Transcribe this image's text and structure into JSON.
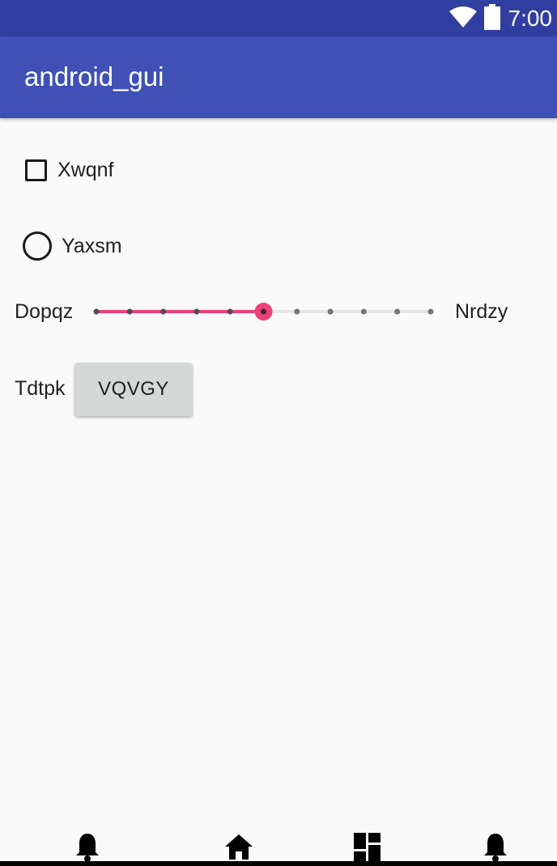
{
  "status_bar": {
    "time": "7:00",
    "icons": [
      "wifi-icon",
      "battery-icon"
    ],
    "color": "#303f9f"
  },
  "app_bar": {
    "title": "android_gui",
    "color": "#3f51b5"
  },
  "checkbox": {
    "label": "Xwqnf",
    "checked": false
  },
  "radio": {
    "label": "Yaxsm",
    "selected": false
  },
  "seekbar": {
    "label_left": "Dopqz",
    "label_right": "Nrdzy",
    "steps": 11,
    "value_index": 5,
    "accent_color": "#ec407a"
  },
  "button_row": {
    "label": "Tdtpk",
    "button_text": "VQVGY"
  },
  "bottom_nav": {
    "icons": [
      "bell-icon",
      "home-icon",
      "dashboard-icon",
      "bell-icon"
    ]
  }
}
